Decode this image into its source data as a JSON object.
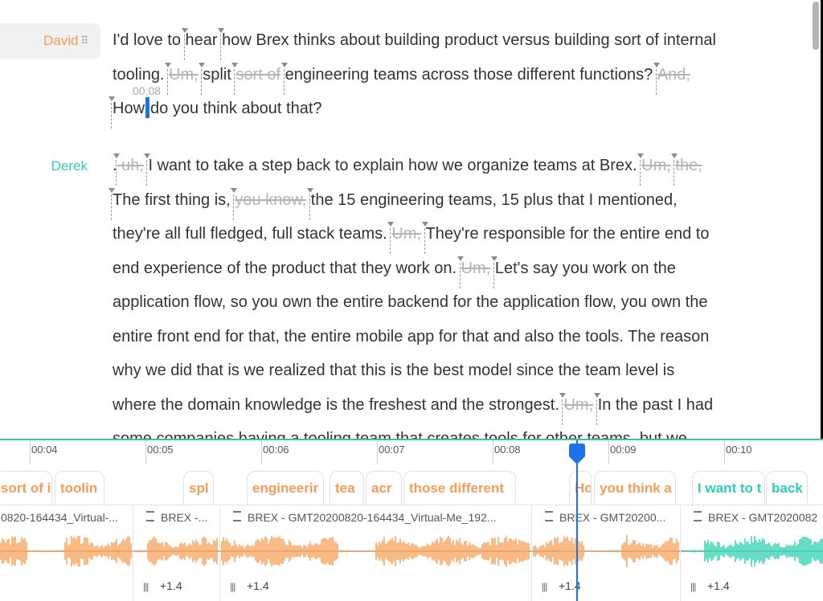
{
  "transcript": {
    "speakers": [
      {
        "name": "David",
        "color": "#f59c58"
      },
      {
        "name": "Derek",
        "color": "#2fcfb0"
      }
    ],
    "grip_glyph": "⠿",
    "time_tip": "00:08",
    "paragraphs": [
      {
        "speaker": "David",
        "lines": [
          [
            {
              "t": "I'd love to "
            },
            {
              "t": "hear",
              "e": 1
            },
            {
              "t": " "
            },
            {
              "t": "how Brex thinks about building product versus building sort of internal",
              "e": 1
            }
          ],
          [
            {
              "t": "tooling. "
            },
            {
              "t": "Um,",
              "c": 1,
              "e": 1
            },
            {
              "t": " "
            },
            {
              "t": "split",
              "e": 1
            },
            {
              "t": " "
            },
            {
              "t": "sort of",
              "c": 1,
              "e": 1
            },
            {
              "t": " "
            },
            {
              "t": "engineering teams across those  different functions? ",
              "e": 1
            },
            {
              "t": "And,",
              "c": 1,
              "e": 1
            }
          ],
          [
            {
              "t": "How",
              "e": 1
            },
            {
              "caret": 1
            },
            {
              "t": "do you think about that?"
            }
          ]
        ]
      },
      {
        "speaker": "Derek",
        "lines": [
          [
            {
              "t": "."
            },
            {
              "t": " uh,",
              "c": 1,
              "e": 1
            },
            {
              "t": " "
            },
            {
              "t": "I want to take a step back to explain how we organize teams at Brex. ",
              "e": 1
            },
            {
              "t": "Um,",
              "c": 1,
              "e": 1
            },
            {
              "t": " "
            },
            {
              "t": "the,",
              "c": 1,
              "e": 1
            }
          ],
          [
            {
              "t": "The first thing is, ",
              "e": 1
            },
            {
              "t": "you know,",
              "c": 1,
              "e": 1
            },
            {
              "t": " "
            },
            {
              "t": "the 15 engineering teams, 15 plus that I mentioned,",
              "e": 1
            }
          ],
          [
            {
              "t": "they're all full fledged, full stack teams. "
            },
            {
              "t": "Um,",
              "c": 1,
              "e": 1
            },
            {
              "t": " "
            },
            {
              "t": "They're responsible for the entire end to",
              "e": 1
            }
          ],
          [
            {
              "t": "end experience of the product that they work on. "
            },
            {
              "t": "Um,",
              "c": 1,
              "e": 1
            },
            {
              "t": " "
            },
            {
              "t": "Let's say you work on the",
              "e": 1
            }
          ],
          [
            {
              "t": "application flow, so you own the entire backend for the application flow, you own the"
            }
          ],
          [
            {
              "t": "entire front end for that, the entire mobile app for that and also the tools. The reason"
            }
          ],
          [
            {
              "t": "why we did that is we realized that this is the best model since the team level is"
            }
          ],
          [
            {
              "t": "where the domain knowledge is the freshest and the strongest. "
            },
            {
              "t": "Um,",
              "c": 1,
              "e": 1
            },
            {
              "t": " "
            },
            {
              "t": "In the past I had",
              "e": 1
            }
          ],
          [
            {
              "t": "some companies having a tooling team that creates tools for other teams, but we"
            }
          ]
        ]
      }
    ]
  },
  "timeline": {
    "ticks": [
      "00:04",
      "00:05",
      "00:06",
      "00:07",
      "00:08",
      "00:09",
      "00:10"
    ],
    "chips": [
      {
        "label": "sort of i",
        "color": "orange"
      },
      {
        "label": "toolin",
        "color": "orange"
      },
      {
        "label": "spl",
        "color": "orange"
      },
      {
        "label": "engineerir",
        "color": "orange"
      },
      {
        "label": "tea",
        "color": "orange"
      },
      {
        "label": "acr",
        "color": "orange"
      },
      {
        "label": "those different",
        "color": "orange"
      },
      {
        "label": "Ho",
        "color": "orange"
      },
      {
        "label": "you think a",
        "color": "orange"
      },
      {
        "label": "I want to t",
        "color": "teal"
      },
      {
        "label": "back",
        "color": "teal"
      }
    ],
    "clips": [
      {
        "label": "0820-164434_Virtual-...",
        "gain": "",
        "wave": "orange"
      },
      {
        "label": "BREX -...",
        "gain": "+1.4",
        "wave": "orange"
      },
      {
        "label": "BREX - GMT20200820-164434_Virtual-Me_192...",
        "gain": "+1.4",
        "wave": "orange"
      },
      {
        "label": "BREX - GMT20200...",
        "gain": "+1.4",
        "wave": "orange"
      },
      {
        "label": "BREX - GMT2020082",
        "gain": "+1.4",
        "wave": "teal"
      }
    ],
    "colors": {
      "orange": "#f8a866",
      "teal": "#3fd6b7",
      "dark": "#333333",
      "playhead": "#1a73e8",
      "accent_border": "#34c7a5"
    }
  }
}
